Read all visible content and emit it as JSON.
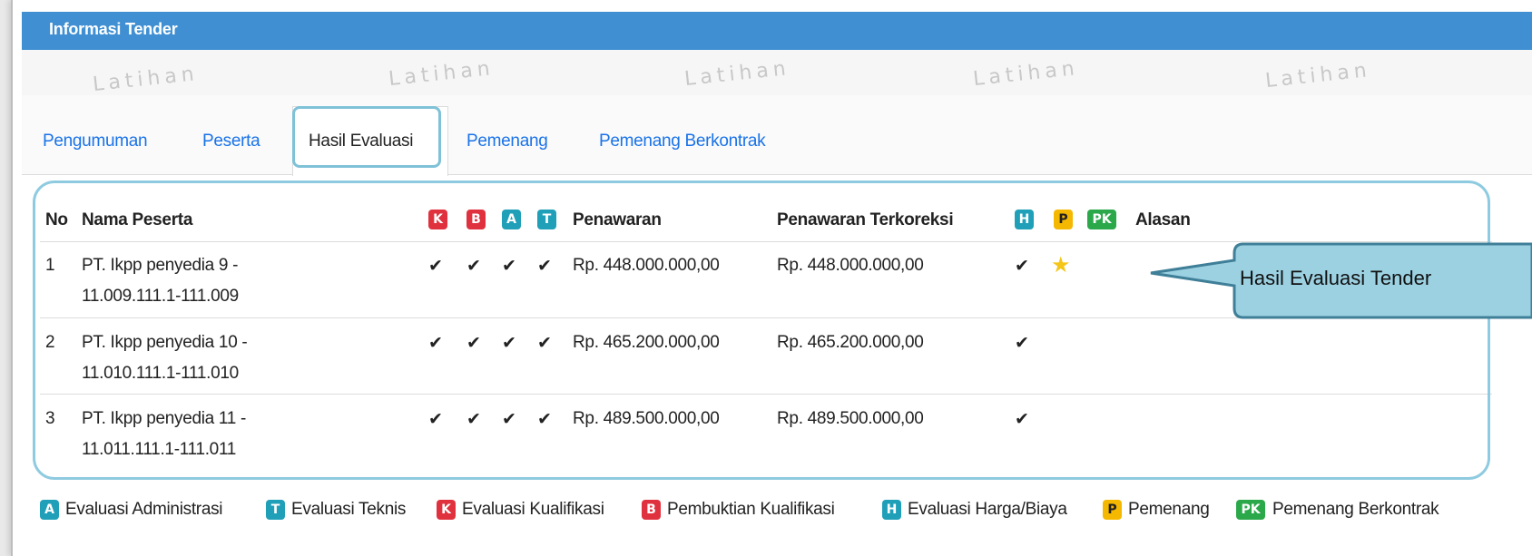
{
  "header": {
    "title": "Informasi Tender"
  },
  "watermark": {
    "text": "Latihan"
  },
  "tabs": [
    {
      "label": "Pengumuman",
      "active": false
    },
    {
      "label": "Peserta",
      "active": false
    },
    {
      "label": "Hasil Evaluasi",
      "active": true
    },
    {
      "label": "Pemenang",
      "active": false
    },
    {
      "label": "Pemenang Berkontrak",
      "active": false
    }
  ],
  "table": {
    "headers": {
      "no": "No",
      "nama": "Nama Peserta",
      "penawaran": "Penawaran",
      "terkoreksi": "Penawaran Terkoreksi",
      "alasan": "Alasan"
    },
    "badges": {
      "k": "K",
      "b": "B",
      "a": "A",
      "t": "T",
      "h": "H",
      "p": "P",
      "pk": "PK"
    },
    "check": "✔",
    "star": "★",
    "rows": [
      {
        "no": "1",
        "nama1": "PT. Ikpp penyedia 9 -",
        "nama2": "11.009.111.1-111.009",
        "penawaran": "Rp. 448.000.000,00",
        "terkoreksi": "Rp. 448.000.000,00",
        "pemenang": true
      },
      {
        "no": "2",
        "nama1": "PT. Ikpp penyedia 10 -",
        "nama2": "11.010.111.1-111.010",
        "penawaran": "Rp. 465.200.000,00",
        "terkoreksi": "Rp. 465.200.000,00",
        "pemenang": false
      },
      {
        "no": "3",
        "nama1": "PT. Ikpp penyedia 11 -",
        "nama2": "11.011.111.1-111.011",
        "penawaran": "Rp. 489.500.000,00",
        "terkoreksi": "Rp. 489.500.000,00",
        "pemenang": false
      }
    ]
  },
  "legend": [
    {
      "badge": "A",
      "label": "Evaluasi Administrasi"
    },
    {
      "badge": "T",
      "label": "Evaluasi Teknis"
    },
    {
      "badge": "K",
      "label": "Evaluasi Kualifikasi"
    },
    {
      "badge": "B",
      "label": "Pembuktian Kualifikasi"
    },
    {
      "badge": "H",
      "label": "Evaluasi Harga/Biaya"
    },
    {
      "badge": "P",
      "label": "Pemenang"
    },
    {
      "badge": "PK",
      "label": "Pemenang Berkontrak"
    }
  ],
  "callout": {
    "text": "Hasil Evaluasi Tender"
  },
  "colors": {
    "header_bg": "#3f8fd2",
    "link": "#1a73e8",
    "badge_red": "#e0323e",
    "badge_teal": "#1f9fb8",
    "badge_yellow": "#f5b800",
    "badge_green": "#2aa84a",
    "highlight": "#8fcbe0",
    "callout_fill": "#9cd1e2",
    "callout_stroke": "#3f7f98"
  }
}
